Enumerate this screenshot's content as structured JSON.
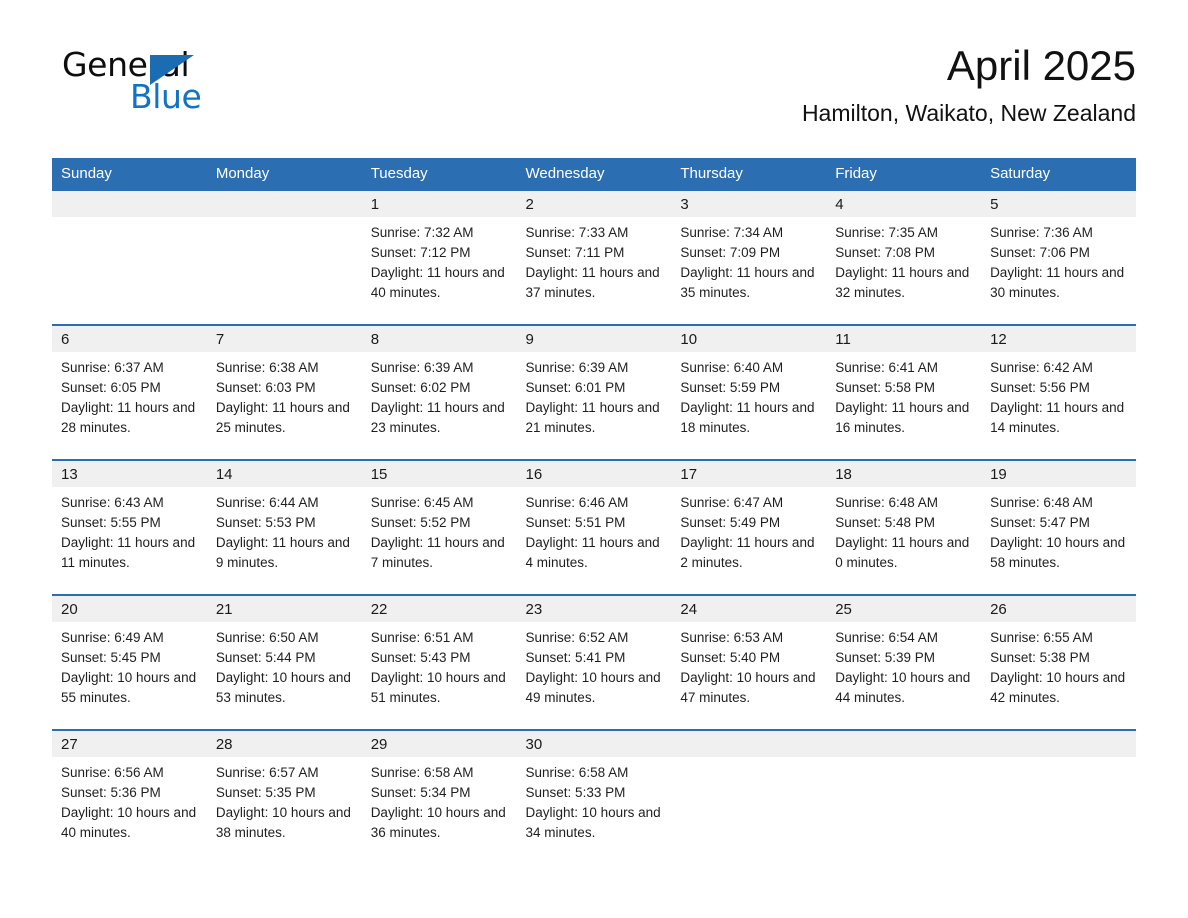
{
  "brand": {
    "name_part1": "General",
    "name_part2": "Blue",
    "triangle_color": "#1b6cb0",
    "blue_color": "#1173c4"
  },
  "header": {
    "month_title": "April 2025",
    "location": "Hamilton, Waikato, New Zealand"
  },
  "theme": {
    "header_blue": "#2b6fb2",
    "daynum_gray": "#f0f0f0",
    "week_divider": "#2b6fb2"
  },
  "columns": [
    "Sunday",
    "Monday",
    "Tuesday",
    "Wednesday",
    "Thursday",
    "Friday",
    "Saturday"
  ],
  "weeks": [
    [
      {
        "day": "",
        "empty": true
      },
      {
        "day": "",
        "empty": true
      },
      {
        "day": "1",
        "sunrise": "Sunrise: 7:32 AM",
        "sunset": "Sunset: 7:12 PM",
        "daylight": "Daylight: 11 hours and 40 minutes."
      },
      {
        "day": "2",
        "sunrise": "Sunrise: 7:33 AM",
        "sunset": "Sunset: 7:11 PM",
        "daylight": "Daylight: 11 hours and 37 minutes."
      },
      {
        "day": "3",
        "sunrise": "Sunrise: 7:34 AM",
        "sunset": "Sunset: 7:09 PM",
        "daylight": "Daylight: 11 hours and 35 minutes."
      },
      {
        "day": "4",
        "sunrise": "Sunrise: 7:35 AM",
        "sunset": "Sunset: 7:08 PM",
        "daylight": "Daylight: 11 hours and 32 minutes."
      },
      {
        "day": "5",
        "sunrise": "Sunrise: 7:36 AM",
        "sunset": "Sunset: 7:06 PM",
        "daylight": "Daylight: 11 hours and 30 minutes."
      }
    ],
    [
      {
        "day": "6",
        "sunrise": "Sunrise: 6:37 AM",
        "sunset": "Sunset: 6:05 PM",
        "daylight": "Daylight: 11 hours and 28 minutes."
      },
      {
        "day": "7",
        "sunrise": "Sunrise: 6:38 AM",
        "sunset": "Sunset: 6:03 PM",
        "daylight": "Daylight: 11 hours and 25 minutes."
      },
      {
        "day": "8",
        "sunrise": "Sunrise: 6:39 AM",
        "sunset": "Sunset: 6:02 PM",
        "daylight": "Daylight: 11 hours and 23 minutes."
      },
      {
        "day": "9",
        "sunrise": "Sunrise: 6:39 AM",
        "sunset": "Sunset: 6:01 PM",
        "daylight": "Daylight: 11 hours and 21 minutes."
      },
      {
        "day": "10",
        "sunrise": "Sunrise: 6:40 AM",
        "sunset": "Sunset: 5:59 PM",
        "daylight": "Daylight: 11 hours and 18 minutes."
      },
      {
        "day": "11",
        "sunrise": "Sunrise: 6:41 AM",
        "sunset": "Sunset: 5:58 PM",
        "daylight": "Daylight: 11 hours and 16 minutes."
      },
      {
        "day": "12",
        "sunrise": "Sunrise: 6:42 AM",
        "sunset": "Sunset: 5:56 PM",
        "daylight": "Daylight: 11 hours and 14 minutes."
      }
    ],
    [
      {
        "day": "13",
        "sunrise": "Sunrise: 6:43 AM",
        "sunset": "Sunset: 5:55 PM",
        "daylight": "Daylight: 11 hours and 11 minutes."
      },
      {
        "day": "14",
        "sunrise": "Sunrise: 6:44 AM",
        "sunset": "Sunset: 5:53 PM",
        "daylight": "Daylight: 11 hours and 9 minutes."
      },
      {
        "day": "15",
        "sunrise": "Sunrise: 6:45 AM",
        "sunset": "Sunset: 5:52 PM",
        "daylight": "Daylight: 11 hours and 7 minutes."
      },
      {
        "day": "16",
        "sunrise": "Sunrise: 6:46 AM",
        "sunset": "Sunset: 5:51 PM",
        "daylight": "Daylight: 11 hours and 4 minutes."
      },
      {
        "day": "17",
        "sunrise": "Sunrise: 6:47 AM",
        "sunset": "Sunset: 5:49 PM",
        "daylight": "Daylight: 11 hours and 2 minutes."
      },
      {
        "day": "18",
        "sunrise": "Sunrise: 6:48 AM",
        "sunset": "Sunset: 5:48 PM",
        "daylight": "Daylight: 11 hours and 0 minutes."
      },
      {
        "day": "19",
        "sunrise": "Sunrise: 6:48 AM",
        "sunset": "Sunset: 5:47 PM",
        "daylight": "Daylight: 10 hours and 58 minutes."
      }
    ],
    [
      {
        "day": "20",
        "sunrise": "Sunrise: 6:49 AM",
        "sunset": "Sunset: 5:45 PM",
        "daylight": "Daylight: 10 hours and 55 minutes."
      },
      {
        "day": "21",
        "sunrise": "Sunrise: 6:50 AM",
        "sunset": "Sunset: 5:44 PM",
        "daylight": "Daylight: 10 hours and 53 minutes."
      },
      {
        "day": "22",
        "sunrise": "Sunrise: 6:51 AM",
        "sunset": "Sunset: 5:43 PM",
        "daylight": "Daylight: 10 hours and 51 minutes."
      },
      {
        "day": "23",
        "sunrise": "Sunrise: 6:52 AM",
        "sunset": "Sunset: 5:41 PM",
        "daylight": "Daylight: 10 hours and 49 minutes."
      },
      {
        "day": "24",
        "sunrise": "Sunrise: 6:53 AM",
        "sunset": "Sunset: 5:40 PM",
        "daylight": "Daylight: 10 hours and 47 minutes."
      },
      {
        "day": "25",
        "sunrise": "Sunrise: 6:54 AM",
        "sunset": "Sunset: 5:39 PM",
        "daylight": "Daylight: 10 hours and 44 minutes."
      },
      {
        "day": "26",
        "sunrise": "Sunrise: 6:55 AM",
        "sunset": "Sunset: 5:38 PM",
        "daylight": "Daylight: 10 hours and 42 minutes."
      }
    ],
    [
      {
        "day": "27",
        "sunrise": "Sunrise: 6:56 AM",
        "sunset": "Sunset: 5:36 PM",
        "daylight": "Daylight: 10 hours and 40 minutes."
      },
      {
        "day": "28",
        "sunrise": "Sunrise: 6:57 AM",
        "sunset": "Sunset: 5:35 PM",
        "daylight": "Daylight: 10 hours and 38 minutes."
      },
      {
        "day": "29",
        "sunrise": "Sunrise: 6:58 AM",
        "sunset": "Sunset: 5:34 PM",
        "daylight": "Daylight: 10 hours and 36 minutes."
      },
      {
        "day": "30",
        "sunrise": "Sunrise: 6:58 AM",
        "sunset": "Sunset: 5:33 PM",
        "daylight": "Daylight: 10 hours and 34 minutes."
      },
      {
        "day": "",
        "empty": true
      },
      {
        "day": "",
        "empty": true
      },
      {
        "day": "",
        "empty": true
      }
    ]
  ]
}
